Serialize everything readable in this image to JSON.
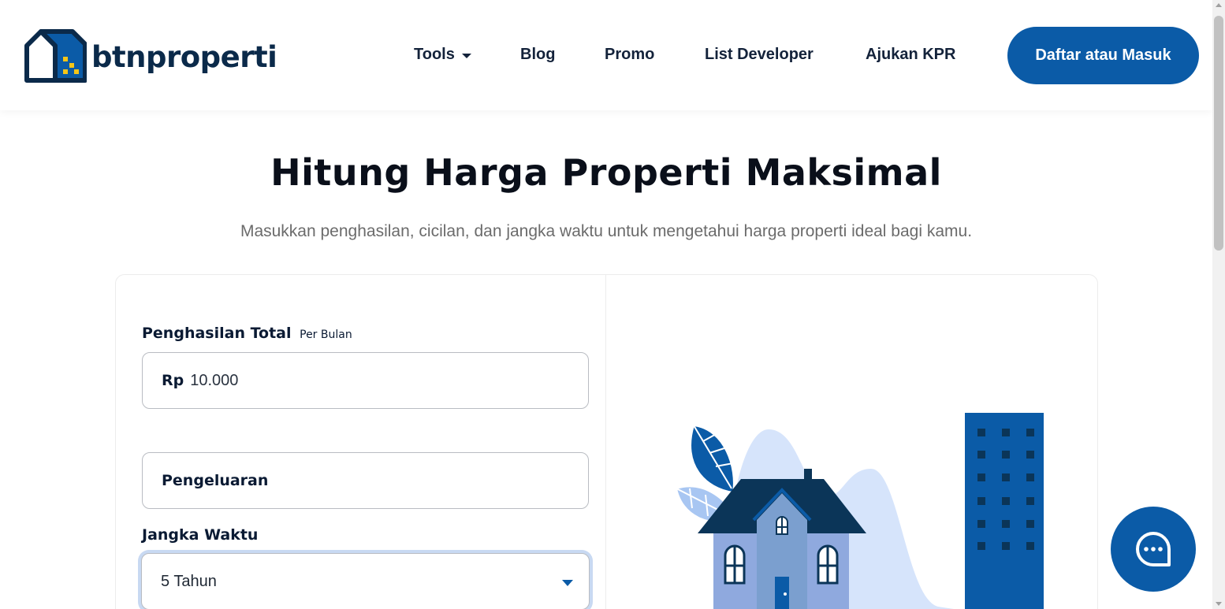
{
  "header": {
    "logo_text": "btnproperti",
    "nav": [
      {
        "label": "Tools",
        "has_dropdown": true
      },
      {
        "label": "Blog"
      },
      {
        "label": "Promo"
      },
      {
        "label": "List Developer"
      },
      {
        "label": "Ajukan KPR"
      }
    ],
    "login_button": "Daftar atau Masuk"
  },
  "hero": {
    "title": "Hitung Harga Properti Maksimal",
    "subtitle": "Masukkan penghasilan, cicilan, dan jangka waktu untuk mengetahui harga properti ideal bagi kamu."
  },
  "form": {
    "income": {
      "label": "Penghasilan Total",
      "label_suffix": "Per Bulan",
      "prefix": "Rp",
      "value": "10.000"
    },
    "expense": {
      "label": "Pengeluaran"
    },
    "term": {
      "label": "Jangka Waktu",
      "value": "5 Tahun"
    }
  },
  "icons": {
    "logo": "house-logo-icon",
    "dropdown": "caret-down-icon",
    "select": "caret-down-icon",
    "chat": "chat-bubble-icon"
  },
  "colors": {
    "brand_navy": "#0b2a4a",
    "brand_blue": "#0b5ba7",
    "accent_yellow": "#f5c518",
    "focus_ring": "#c8d9f2"
  }
}
